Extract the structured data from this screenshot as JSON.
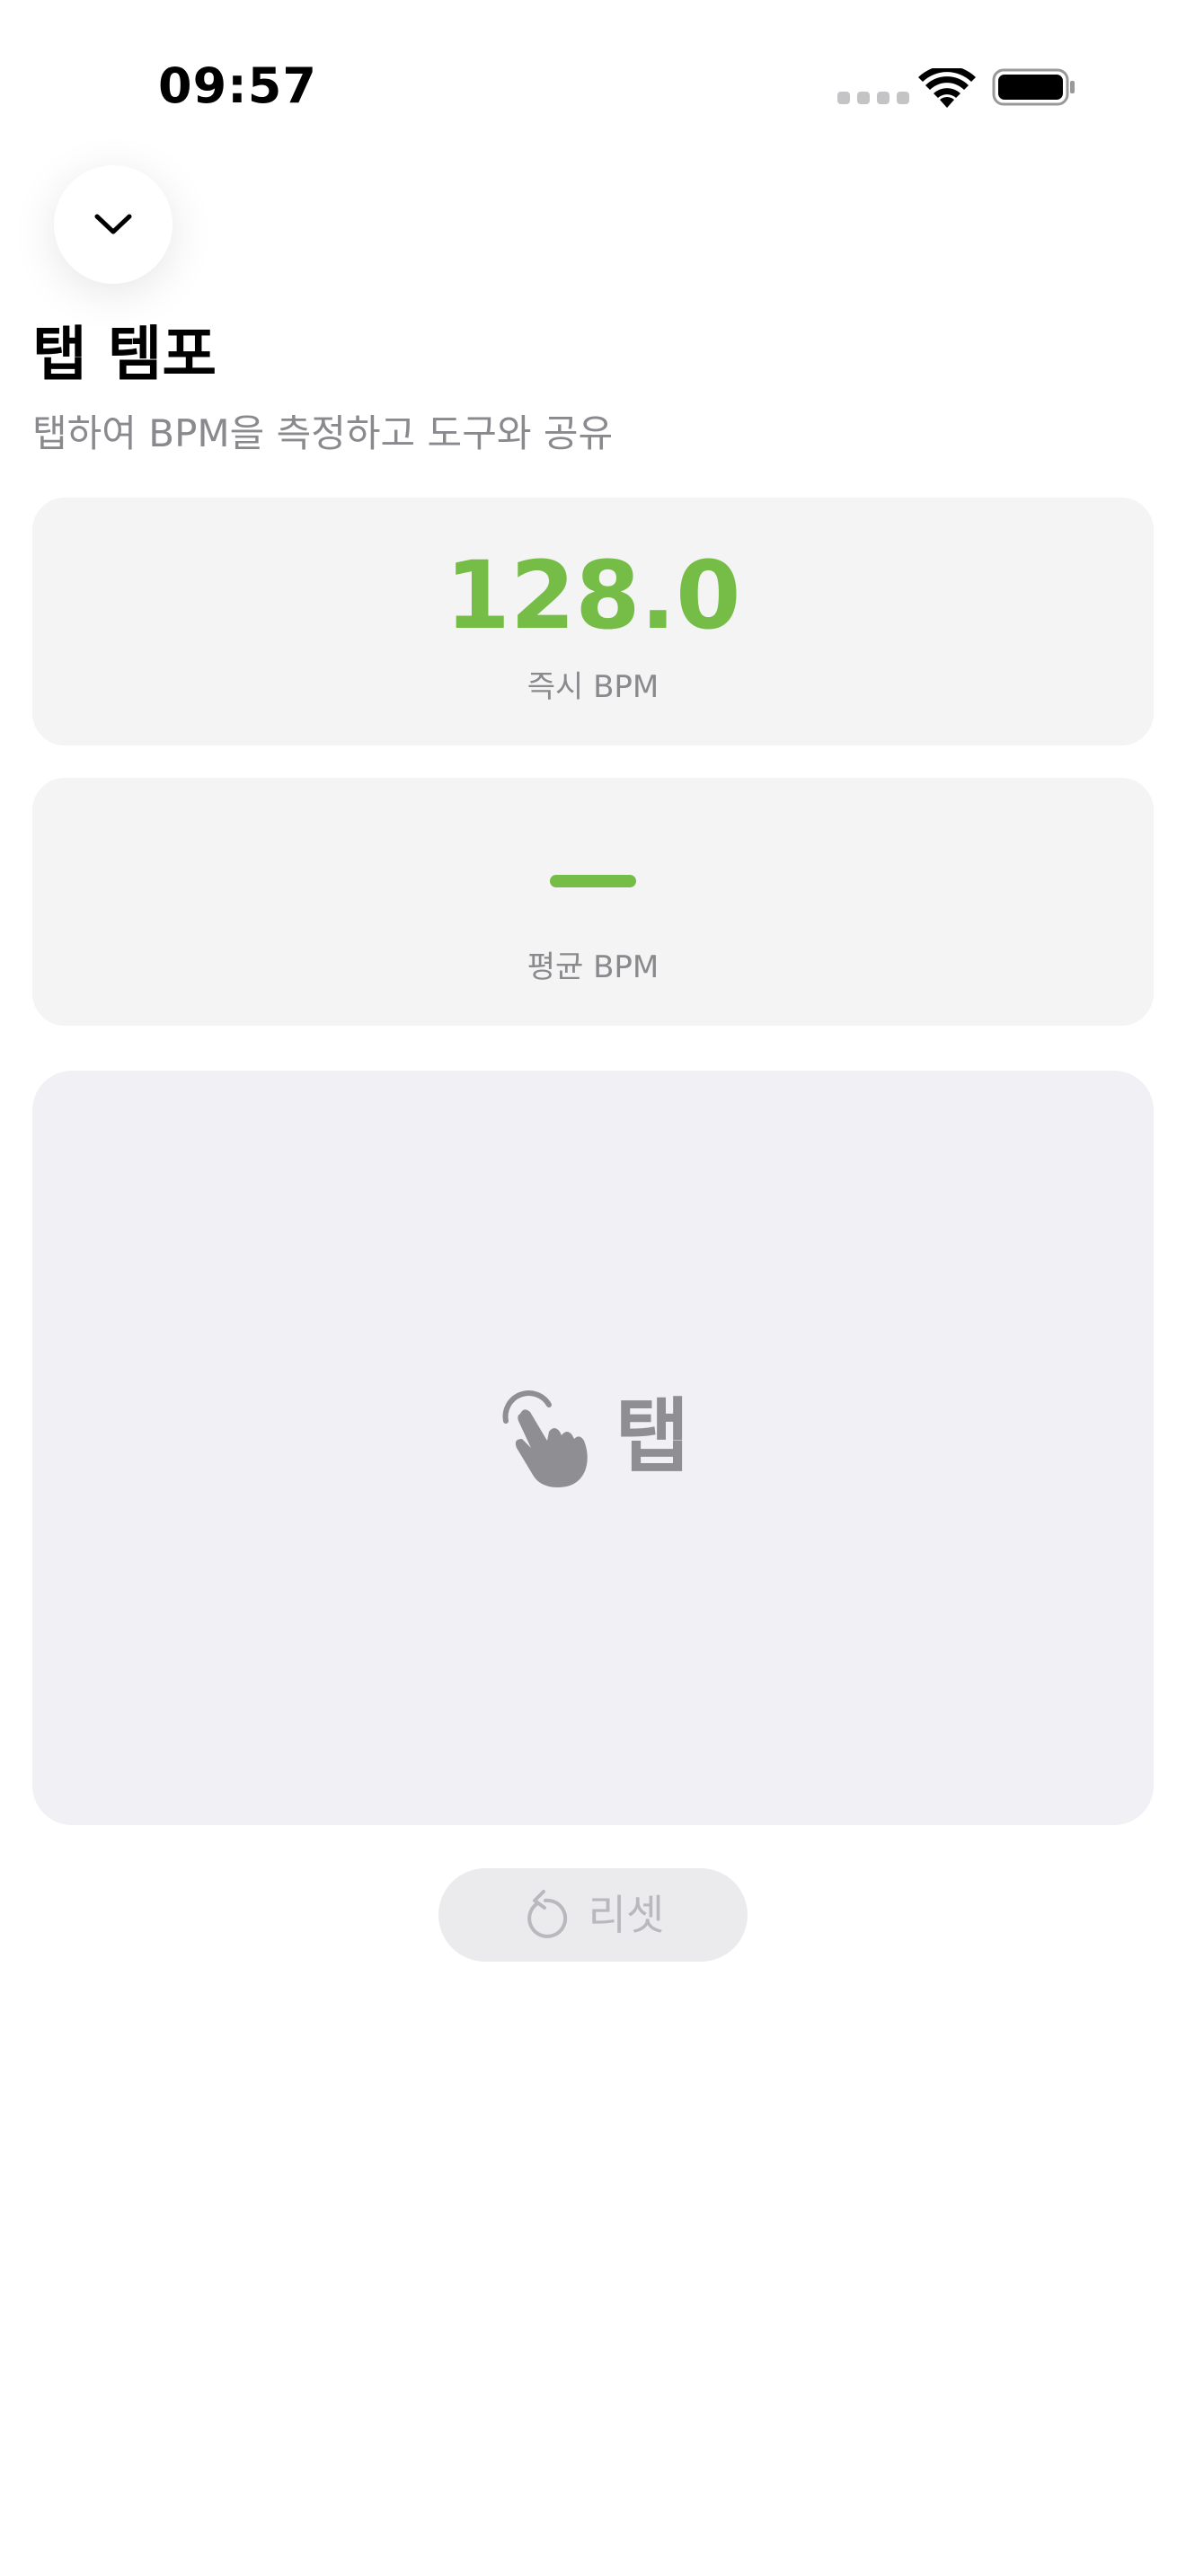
{
  "status_bar": {
    "time": "09:57"
  },
  "header": {
    "title": "탭 템포",
    "subtitle": "탭하여 BPM을 측정하고 도구와 공유"
  },
  "instant_card": {
    "value": "128.0",
    "label": "즉시 BPM"
  },
  "average_card": {
    "label": "평균 BPM"
  },
  "tap_pad": {
    "label": "탭",
    "icon": "hand-tap-icon"
  },
  "reset_button": {
    "label": "리셋",
    "icon": "reset-arrow-icon"
  },
  "colors": {
    "accent": "#76bd47",
    "card_bg": "#f4f4f5",
    "tap_bg": "#f1f1f5",
    "secondary_text": "#8a8a8e"
  }
}
